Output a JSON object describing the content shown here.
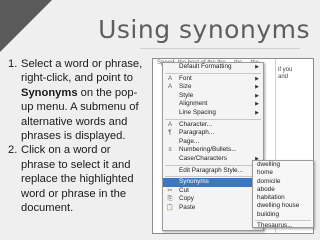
{
  "title": "Using synonyms",
  "steps": [
    {
      "num": "1.",
      "pre": "Select a word or phrase, right-click, and point to ",
      "bold": "Synonyms",
      "post": " on the pop-up menu. A submenu of alternative words and phrases is displayed."
    },
    {
      "num": "2.",
      "pre": "Click on a word or phrase to select it and replace the highlighted word or phrase in the document.",
      "bold": "",
      "post": ""
    }
  ],
  "screenshot": {
    "doc_text": "Speed. the best of the the ... the ... the",
    "doc_side": "if you\nand",
    "menu": {
      "items": [
        {
          "label": "Default Formatting",
          "icon": "",
          "arrow": true
        },
        {
          "label": "Font",
          "icon": "A",
          "arrow": true
        },
        {
          "label": "Size",
          "icon": "A",
          "arrow": true
        },
        {
          "label": "Style",
          "icon": "",
          "arrow": true
        },
        {
          "label": "Alignment",
          "icon": "",
          "arrow": true
        },
        {
          "label": "Line Spacing",
          "icon": "",
          "arrow": true
        },
        {
          "label": "Character...",
          "icon": "A",
          "arrow": false
        },
        {
          "label": "Paragraph...",
          "icon": "¶",
          "arrow": false
        },
        {
          "label": "Page...",
          "icon": "",
          "arrow": false
        },
        {
          "label": "Numbering/Bullets...",
          "icon": "≡",
          "arrow": false
        },
        {
          "label": "Case/Characters",
          "icon": "",
          "arrow": true
        },
        {
          "label": "Edit Paragraph Style...",
          "icon": "",
          "arrow": false
        },
        {
          "label": "Synonyms",
          "icon": "",
          "arrow": true
        },
        {
          "label": "Cut",
          "icon": "✂",
          "arrow": false
        },
        {
          "label": "Copy",
          "icon": "⎘",
          "arrow": false
        },
        {
          "label": "Paste",
          "icon": "📋",
          "arrow": false
        }
      ],
      "highlighted": "Synonyms"
    },
    "submenu": {
      "items": [
        "dwelling",
        "home",
        "domicile",
        "abode",
        "habitation",
        "dwelling house",
        "building",
        "Thesaurus..."
      ]
    }
  }
}
